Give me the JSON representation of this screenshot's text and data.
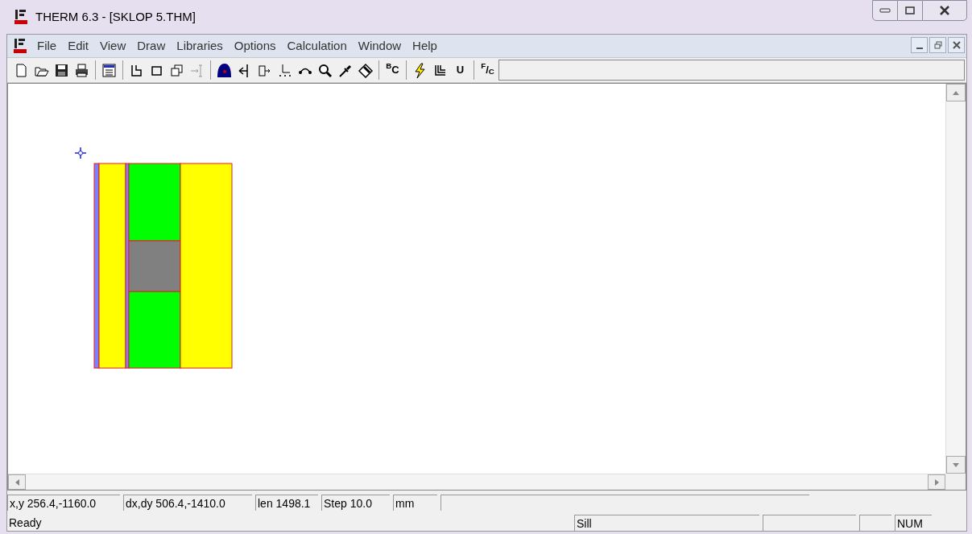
{
  "window": {
    "title": "THERM 6.3 - [SKLOP 5.THM]"
  },
  "menu": [
    "File",
    "Edit",
    "View",
    "Draw",
    "Libraries",
    "Options",
    "Calculation",
    "Window",
    "Help"
  ],
  "toolbar": [
    {
      "kind": "new"
    },
    {
      "kind": "open"
    },
    {
      "kind": "save"
    },
    {
      "kind": "print"
    },
    {
      "kind": "sep"
    },
    {
      "kind": "properties"
    },
    {
      "kind": "sep"
    },
    {
      "kind": "polygon"
    },
    {
      "kind": "rect"
    },
    {
      "kind": "copy"
    },
    {
      "kind": "insert"
    },
    {
      "kind": "sep"
    },
    {
      "kind": "fill"
    },
    {
      "kind": "locator"
    },
    {
      "kind": "export"
    },
    {
      "kind": "snap"
    },
    {
      "kind": "arc"
    },
    {
      "kind": "zoom"
    },
    {
      "kind": "dropper"
    },
    {
      "kind": "rotate"
    },
    {
      "kind": "sep"
    },
    {
      "kind": "text",
      "label": "$^{B}$C"
    },
    {
      "kind": "sep"
    },
    {
      "kind": "bolt"
    },
    {
      "kind": "lines"
    },
    {
      "kind": "text",
      "label": "U"
    },
    {
      "kind": "sep"
    },
    {
      "kind": "text",
      "label": "$^{F}$/$_{C}$"
    }
  ],
  "drawing": {
    "regions": [
      {
        "color": "#8080ff"
      },
      {
        "color": "#ffff00"
      },
      {
        "color": "#8080ff"
      },
      {
        "color": "#00ff00"
      },
      {
        "color": "#808080"
      },
      {
        "color": "#00ff00"
      },
      {
        "color": "#ffff00"
      }
    ]
  },
  "status_bar": {
    "row1": [
      "x,y 256.4,-1160.0",
      "dx,dy 506.4,-1410.0",
      "len 1498.1",
      "Step  10.0",
      "mm"
    ],
    "message": "Ready",
    "row2": [
      "Sill",
      "NUM"
    ]
  }
}
